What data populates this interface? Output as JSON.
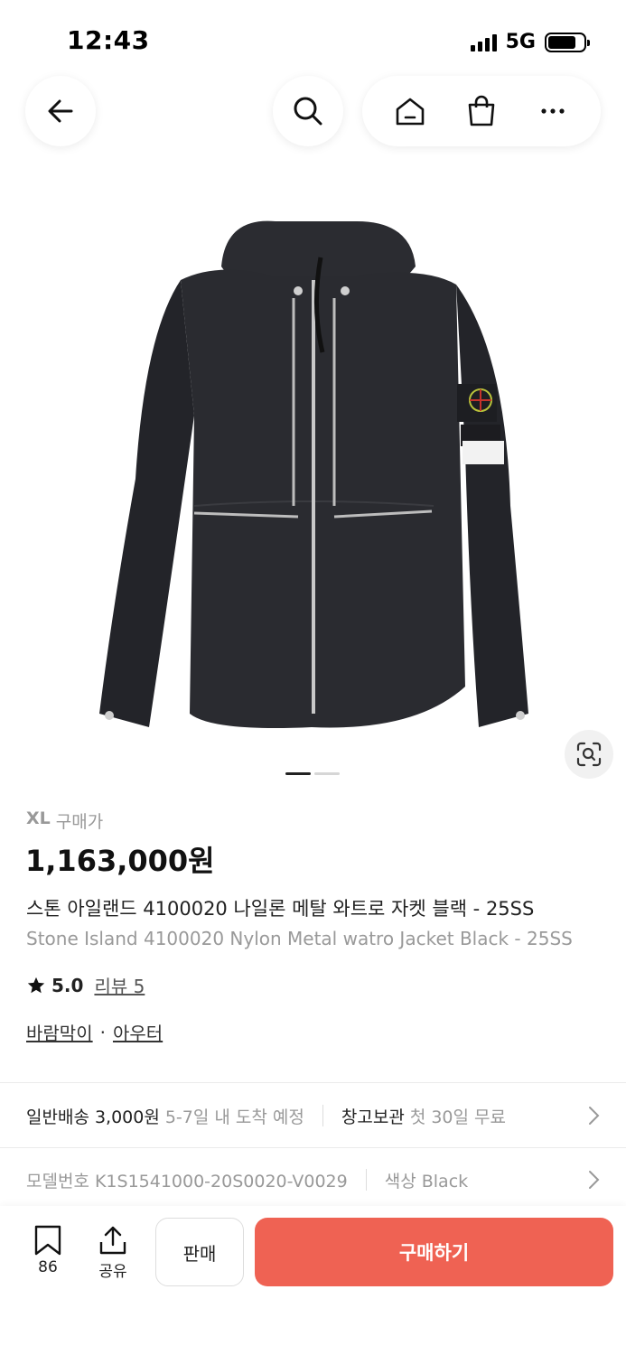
{
  "status": {
    "time": "12:43",
    "network": "5G"
  },
  "product": {
    "size": "XL",
    "price_label": "구매가",
    "price": "1,163,000원",
    "name_ko": "스톤 아일랜드 4100020 나일론 메탈 와트로 자켓 블랙 - 25SS",
    "name_en": "Stone Island 4100020 Nylon Metal watro Jacket Black - 25SS",
    "rating": "5.0",
    "review": "리뷰 5",
    "category_1": "바람막이",
    "category_sep": "·",
    "category_2": "아우터"
  },
  "shipping": {
    "label": "일반배송 3,000원",
    "eta": "5-7일 내 도착 예정",
    "storage_label": "창고보관",
    "storage_note": "첫 30일 무료"
  },
  "details": {
    "model": "모델번호 K1S1541000-20S0020-V0029",
    "color": "색상 Black"
  },
  "bottom": {
    "bookmark_count": "86",
    "share_label": "공유",
    "sell_label": "판매",
    "buy_label": "구매하기"
  },
  "carousel": {
    "current": 1,
    "total": 2
  },
  "icons": [
    "back-arrow-icon",
    "search-icon",
    "home-icon",
    "shopping-bag-icon",
    "more-icon",
    "lens-icon",
    "star-icon",
    "bookmark-icon",
    "share-icon",
    "chevron-right-icon"
  ],
  "colors": {
    "accent": "#ef6253",
    "muted": "#999999"
  }
}
